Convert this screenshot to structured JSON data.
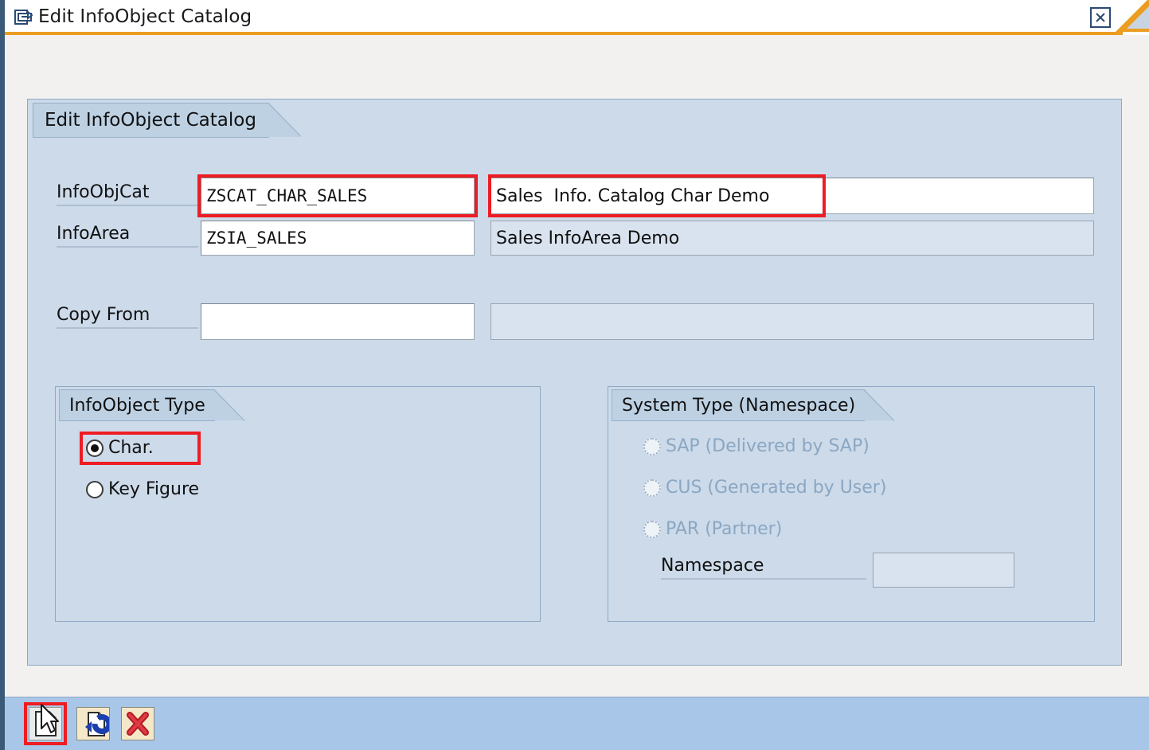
{
  "window": {
    "title": "Edit InfoObject Catalog",
    "title_icon": "edit-document-icon",
    "close_label": "☒"
  },
  "panel": {
    "header": "Edit InfoObject Catalog"
  },
  "form": {
    "infoobjcat": {
      "label": "InfoObjCat",
      "value": "ZSCAT_CHAR_SALES",
      "description": "Sales  Info. Catalog Char Demo",
      "highlighted": true
    },
    "infoarea": {
      "label": "InfoArea",
      "value": "ZSIA_SALES",
      "description": "Sales InfoArea Demo",
      "highlighted": false
    },
    "copy_from": {
      "label": "Copy From",
      "value": "",
      "description": ""
    }
  },
  "infoobject_type": {
    "header": "InfoObject Type",
    "options": [
      {
        "label": "Char.",
        "checked": true,
        "disabled": false,
        "highlighted": true
      },
      {
        "label": "Key Figure",
        "checked": false,
        "disabled": false,
        "highlighted": false
      }
    ]
  },
  "system_type": {
    "header": "System Type (Namespace)",
    "options": [
      {
        "label": "SAP (Delivered by SAP)",
        "checked": false,
        "disabled": true
      },
      {
        "label": "CUS (Generated by User)",
        "checked": false,
        "disabled": true
      },
      {
        "label": "PAR (Partner)",
        "checked": false,
        "disabled": true
      }
    ],
    "namespace": {
      "label": "Namespace",
      "value": ""
    }
  },
  "toolbar": {
    "buttons": [
      {
        "name": "create-button",
        "icon": "new-document-icon",
        "highlighted": true
      },
      {
        "name": "check-button",
        "icon": "refresh-document-icon",
        "highlighted": false
      },
      {
        "name": "cancel-button",
        "icon": "red-x-icon",
        "highlighted": false
      }
    ]
  },
  "colors": {
    "highlight": "#ee1c23",
    "title_accent": "#eb9d22",
    "panel_bg": "#ccdaea",
    "toolbar_bg": "#a8c6e8"
  }
}
